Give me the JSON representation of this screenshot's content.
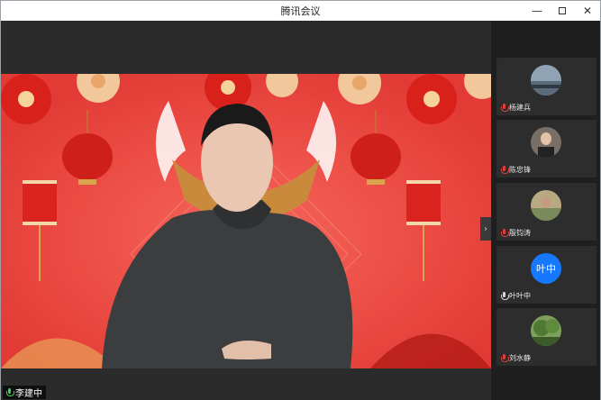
{
  "window": {
    "title": "腾讯会议"
  },
  "main_speaker": {
    "name": "李建中"
  },
  "participants": [
    {
      "name": "杨建兵",
      "mic": "red"
    },
    {
      "name": "陈忠锋",
      "mic": "red"
    },
    {
      "name": "殷钧涛",
      "mic": "red"
    },
    {
      "name": "叶叶中",
      "mic": "white",
      "avatar_text": "叶中"
    },
    {
      "name": "刘水静",
      "mic": "red"
    }
  ],
  "colors": {
    "stage_bg": "#ef4a42",
    "avatar_blue": "#1677ff",
    "mic_active": "#3ecf5a"
  }
}
